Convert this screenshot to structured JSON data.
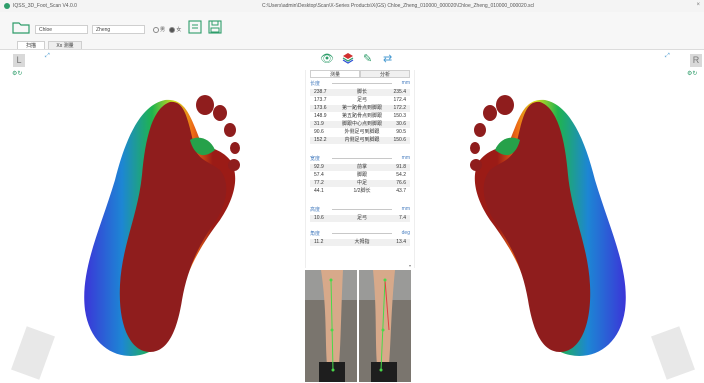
{
  "titlebar": {
    "app_title": "IQSS_3D_Foot_Scan V4.0.0",
    "file_path": "C:\\Users\\admin\\Desktop\\Scan\\X-Series Products\\X(GS) Chloe_Zheng_010000_000020\\Chloe_Zheng_010000_000020.scl",
    "close": "×"
  },
  "patient": {
    "first_name": "Chloe",
    "last_name": "Zheng",
    "gender_male": "男",
    "gender_female": "女"
  },
  "tabs": [
    {
      "label": "扫描"
    },
    {
      "label": "Xx 测量"
    }
  ],
  "side_labels": {
    "left": "L",
    "right": "R"
  },
  "panel": {
    "tabs": [
      {
        "label": "测量"
      },
      {
        "label": "分析"
      }
    ],
    "length_section": {
      "header": "长度",
      "unit": "mm",
      "rows": [
        {
          "left": "238.7",
          "label": "脚长",
          "right": "235.4"
        },
        {
          "left": "173.7",
          "label": "足弓",
          "right": "172.4"
        },
        {
          "left": "173.6",
          "label": "第一跖骨点到脚跟",
          "right": "172.2"
        },
        {
          "left": "148.9",
          "label": "第五跖骨点到脚跟",
          "right": "150.3"
        },
        {
          "left": "31.9",
          "label": "脚跟中心点到脚跟",
          "right": "30.6"
        },
        {
          "left": "90.6",
          "label": "外侧足弓到脚跟",
          "right": "90.5"
        },
        {
          "left": "152.2",
          "label": "内侧足弓到脚跟",
          "right": "150.6"
        }
      ]
    },
    "width_section": {
      "header": "宽度",
      "unit": "mm",
      "rows": [
        {
          "left": "92.9",
          "label": "前掌",
          "right": "91.8"
        },
        {
          "left": "57.4",
          "label": "脚跟",
          "right": "54.2"
        },
        {
          "left": "77.2",
          "label": "中足",
          "right": "76.6"
        },
        {
          "left": "44.1",
          "label": "1/2脚长",
          "right": "43.7"
        }
      ]
    },
    "height_section": {
      "header": "高度",
      "unit": "mm",
      "rows": [
        {
          "left": "10.6",
          "label": "足弓",
          "right": "7.4"
        }
      ]
    },
    "angle_section": {
      "header": "角度",
      "unit": "deg",
      "rows": [
        {
          "left": "11.2",
          "label": "大拇指",
          "right": "13.4"
        }
      ]
    }
  },
  "icons": {
    "folder": "folder-icon",
    "save": "save-icon",
    "export": "export-icon",
    "eye": "eye-icon",
    "layers": "layers-icon",
    "pen": "pen-icon",
    "swap": "swap-icon"
  },
  "colors": {
    "accent": "#2e9d6a",
    "heatmap_high": "#8b1a1a",
    "heatmap_mid": "#2fb34a",
    "heatmap_low": "#2c4fd6"
  }
}
